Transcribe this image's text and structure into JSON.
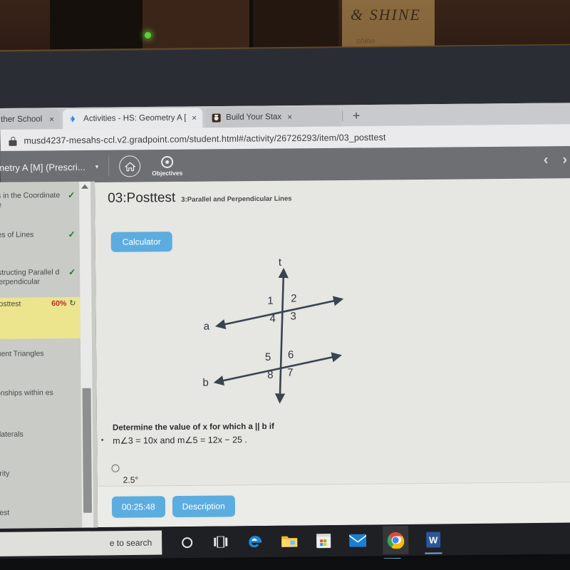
{
  "room": {
    "sign_text": "& SHINE",
    "sign_subtext": "shine",
    "led_indicator": "power-led"
  },
  "browser": {
    "tabs": [
      {
        "label": "ther School G",
        "favicon": "page-icon",
        "active": false,
        "close": "×"
      },
      {
        "label": "Activities - HS: Geometry A [M] (",
        "favicon": "gradpoint-icon",
        "active": true,
        "close": "×"
      },
      {
        "label": "Build Your Stax",
        "favicon": "stax-icon",
        "active": false,
        "close": "×"
      }
    ],
    "new_tab_label": "+",
    "url": "musd4237-mesahs-ccl.v2.gradpoint.com/student.html#/activity/26726293/item/03_posttest",
    "lock_icon": "lock-icon"
  },
  "appbar": {
    "course_title": "ometry A [M] (Prescri...",
    "caret": "▾",
    "home_icon": "home-icon",
    "objectives_label": "Objectives",
    "objectives_icon": "target-icon",
    "prev_chevron": "‹",
    "next_chevron": "›"
  },
  "sidebar": {
    "items": [
      {
        "label": "es in the Coordinate ne",
        "status": "complete",
        "check": "✓"
      },
      {
        "label": "pes of Lines",
        "status": "complete",
        "check": "✓"
      },
      {
        "label": "nstructing Parallel d Perpendicular",
        "status": "complete",
        "check": "✓"
      },
      {
        "label": "Posttest",
        "status": "current",
        "percent": "60%",
        "refresh_icon": "refresh-icon"
      },
      {
        "label": "ruent Triangles",
        "status": "none"
      },
      {
        "label": "ionships within es",
        "status": "none"
      },
      {
        "label": "rilaterals",
        "status": "none"
      },
      {
        "label": "arity",
        "status": "none"
      },
      {
        "label": "Test",
        "status": "none"
      }
    ],
    "scroll_up": "scroll-up-arrow",
    "scroll_down": "scroll-down-arrow"
  },
  "content": {
    "item_title": "03:Posttest",
    "item_subtitle": "3:Parallel and Perpendicular Lines",
    "calculator_label": "Calculator",
    "question_line1": "Determine the value of x for which a || b if",
    "question_line2": "m∠3 = 10x  and  m∠5 = 12x − 25 .",
    "choices": [
      {
        "label": "2.5°",
        "selected": false
      }
    ],
    "timer": "00:25:48",
    "description_label": "Description"
  },
  "figure": {
    "type": "two-parallel-lines-cut-by-transversal",
    "transversal_label": "t",
    "line_a_label": "a",
    "line_b_label": "b",
    "angle_labels_top": [
      "1",
      "2",
      "4",
      "3"
    ],
    "angle_labels_bottom": [
      "5",
      "6",
      "8",
      "7"
    ],
    "stroke_color": "#3a4450"
  },
  "taskbar": {
    "search_placeholder": "e to search",
    "icons": [
      "cortana-icon",
      "task-view-icon",
      "edge-icon",
      "file-explorer-icon",
      "microsoft-store-icon",
      "mail-icon",
      "chrome-icon",
      "word-icon"
    ]
  },
  "colors": {
    "accent_blue": "#5caddf",
    "highlight_yellow": "#ece58d",
    "percent_red": "#c02b22",
    "check_green": "#1b7a2c",
    "appbar_gray": "#6d6f72"
  }
}
